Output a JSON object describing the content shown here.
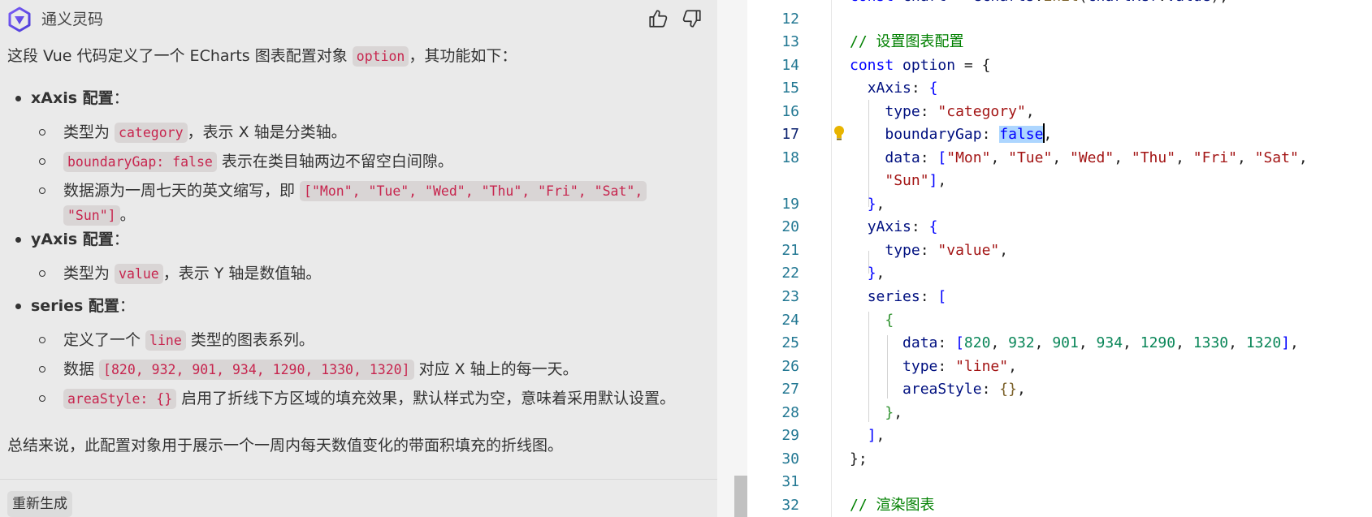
{
  "chat": {
    "assistant_name": "通义灵码",
    "intro": {
      "before": "这段 Vue 代码定义了一个 ECharts 图表配置对象 ",
      "code": "option",
      "after": "，其功能如下："
    },
    "xaxis": {
      "label": "xAxis 配置",
      "colon": "：",
      "item1": {
        "before": "类型为 ",
        "code": "category",
        "after": "，表示 X 轴是分类轴。"
      },
      "item2": {
        "code": "boundaryGap: false",
        "after": " 表示在类目轴两边不留空白间隙。"
      },
      "item3": {
        "before": "数据源为一周七天的英文缩写，即 ",
        "code1": "[\"Mon\", \"Tue\", \"Wed\", \"Thu\", \"Fri\", \"Sat\",",
        "code2": "\"Sun\"]",
        "after": "。"
      }
    },
    "yaxis": {
      "label": "yAxis 配置",
      "colon": "：",
      "item1": {
        "before": "类型为 ",
        "code": "value",
        "after": "，表示 Y 轴是数值轴。"
      }
    },
    "series": {
      "label": "series 配置",
      "colon": "：",
      "item1": {
        "before": "定义了一个 ",
        "code": "line",
        "after": " 类型的图表系列。"
      },
      "item2": {
        "before": "数据 ",
        "code": "[820, 932, 901, 934, 1290, 1330, 1320]",
        "after": " 对应 X 轴上的每一天。"
      },
      "item3": {
        "code": "areaStyle: {}",
        "after": " 启用了折线下方区域的填充效果，默认样式为空，意味着采用默认设置。"
      }
    },
    "summary": "总结来说，此配置对象用于展示一个一周内每天数值变化的带面积填充的折线图。",
    "regenerate_label": "重新生成"
  },
  "editor": {
    "line_numbers": [
      "12",
      "13",
      "14",
      "15",
      "16",
      "17",
      "18",
      "",
      "19",
      "20",
      "21",
      "22",
      "23",
      "24",
      "25",
      "26",
      "27",
      "28",
      "29",
      "30",
      "31",
      "32"
    ],
    "top_partial": "const chart = echarts.init(chartRef.value);",
    "active_line": "17",
    "icons": [
      "lightbulb-icon"
    ]
  },
  "colors": {
    "keyword": "#0000ff",
    "property": "#001080",
    "string": "#a31515",
    "number": "#098658",
    "comment": "#008000",
    "line_number": "#237893",
    "inline_code": "#c7254e",
    "chat_bg": "#eaeaea",
    "selection": "#add6ff"
  }
}
